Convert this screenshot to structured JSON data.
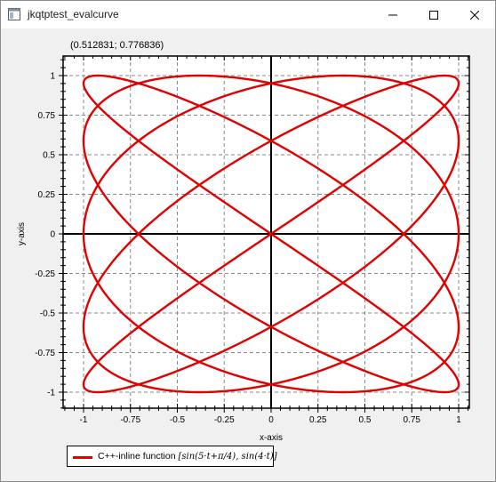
{
  "window": {
    "title": "jkqtptest_evalcurve",
    "icon": "app-window-icon",
    "controls": [
      "minimize-icon",
      "maximize-icon",
      "close-icon"
    ]
  },
  "coordinate_readout": "(0.512831; 0.776836)",
  "chart_data": {
    "type": "line",
    "function": "x = sin(5·t + π/4), y = sin(4·t)",
    "parametric": {
      "x_frequency": 5,
      "x_phase": 0.7853981634,
      "y_frequency": 4
    },
    "xlabel": "x-axis",
    "ylabel": "y-axis",
    "xlim": [
      -1.1,
      1.1
    ],
    "ylim": [
      -1.1,
      1.1
    ],
    "x_ticks": [
      -1,
      -0.75,
      -0.5,
      -0.25,
      0,
      0.25,
      0.5,
      0.75,
      1
    ],
    "y_ticks": [
      -1,
      -0.75,
      -0.5,
      -0.25,
      0,
      0.25,
      0.5,
      0.75,
      1
    ],
    "x_tick_labels": [
      "-1",
      "-0.75",
      "-0.5",
      "-0.25",
      "0",
      "0.25",
      "0.5",
      "0.75",
      "1"
    ],
    "y_tick_labels": [
      "-1",
      "-0.75",
      "-0.5",
      "-0.25",
      "0",
      "0.25",
      "0.5",
      "0.75",
      "1"
    ],
    "grid": true,
    "series": [
      {
        "name": "C++-inline function",
        "formula": "[sin(5·t+π/4), sin(4·t)]",
        "color": "#e00000"
      }
    ],
    "legend_position": "bottom-left, outside plot"
  }
}
